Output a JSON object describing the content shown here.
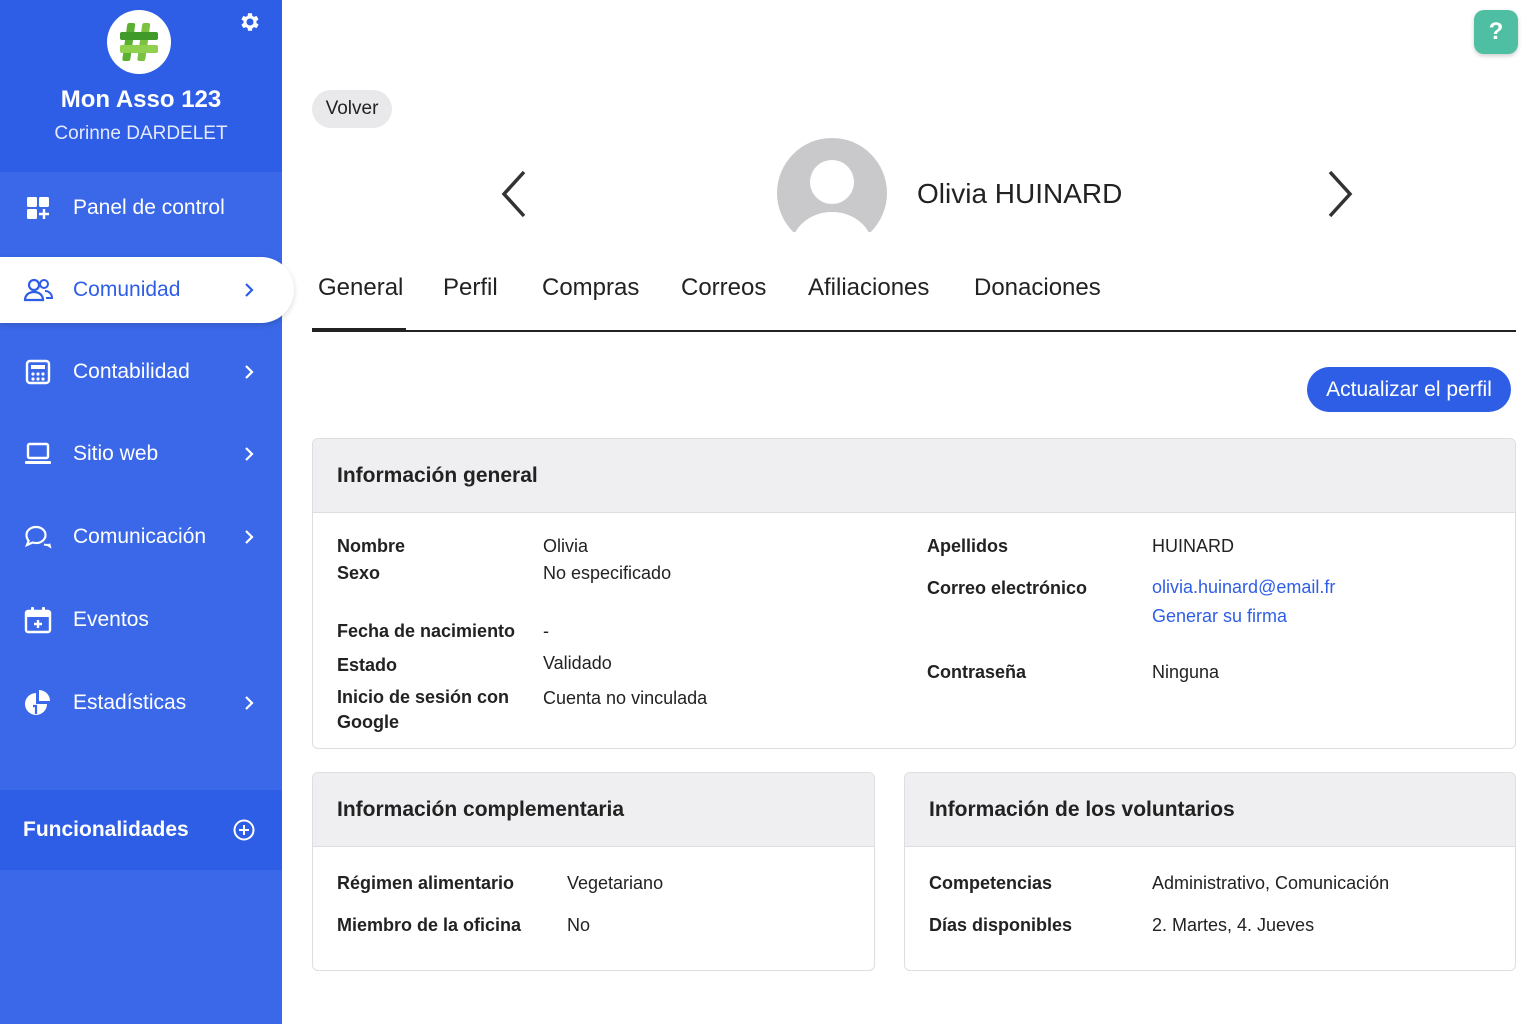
{
  "sidebar": {
    "org_name": "Mon Asso 123",
    "user_name": "Corinne DARDELET",
    "items": [
      {
        "label": "Panel de control"
      },
      {
        "label": "Comunidad"
      },
      {
        "label": "Contabilidad"
      },
      {
        "label": "Sitio web"
      },
      {
        "label": "Comunicación"
      },
      {
        "label": "Eventos"
      },
      {
        "label": "Estadísticas"
      }
    ],
    "features_label": "Funcionalidades"
  },
  "help": {
    "label": "?"
  },
  "header": {
    "back_label": "Volver",
    "person_name": "Olivia HUINARD"
  },
  "tabs": [
    {
      "label": "General"
    },
    {
      "label": "Perfil"
    },
    {
      "label": "Compras"
    },
    {
      "label": "Correos"
    },
    {
      "label": "Afiliaciones"
    },
    {
      "label": "Donaciones"
    }
  ],
  "active_tab": "General",
  "update_button": "Actualizar el perfil",
  "general_info": {
    "title": "Información general",
    "nombre_label": "Nombre",
    "nombre_value": "Olivia",
    "sexo_label": "Sexo",
    "sexo_value": "No especificado",
    "fecha_label": "Fecha de nacimiento",
    "fecha_value": "-",
    "estado_label": "Estado",
    "estado_value": "Validado",
    "google_label_1": "Inicio de sesión con",
    "google_label_2": "Google",
    "google_value": "Cuenta no vinculada",
    "apellidos_label": "Apellidos",
    "apellidos_value": "HUINARD",
    "email_label": "Correo electrónico",
    "email_value": "olivia.huinard@email.fr",
    "firma_link": "Generar su firma",
    "password_label": "Contraseña",
    "password_value": "Ninguna"
  },
  "complementary_info": {
    "title": "Información complementaria",
    "regimen_label": "Régimen alimentario",
    "regimen_value": "Vegetariano",
    "oficina_label": "Miembro de la oficina",
    "oficina_value": "No"
  },
  "volunteer_info": {
    "title": "Información de los voluntarios",
    "competencias_label": "Competencias",
    "competencias_value": "Administrativo, Comunicación",
    "dias_label": "Días disponibles",
    "dias_value": "2. Martes, 4. Jueves"
  },
  "colors": {
    "sidebar": "#3a68e8",
    "sidebar_dark": "#2f5ee6",
    "primary": "#2f5ee6",
    "help": "#4fbfa3",
    "logo_green": "#5bb031"
  },
  "icons": {
    "logo": "hashtag-logo-icon",
    "settings": "gear-icon",
    "help": "question-icon",
    "nav": [
      "dashboard-icon",
      "users-icon",
      "calculator-icon",
      "laptop-icon",
      "chat-icon",
      "calendar-icon",
      "pie-chart-icon"
    ],
    "features": "plus-circle-icon",
    "prev": "chevron-left-icon",
    "next": "chevron-right-icon",
    "avatar": "user-avatar-icon"
  }
}
